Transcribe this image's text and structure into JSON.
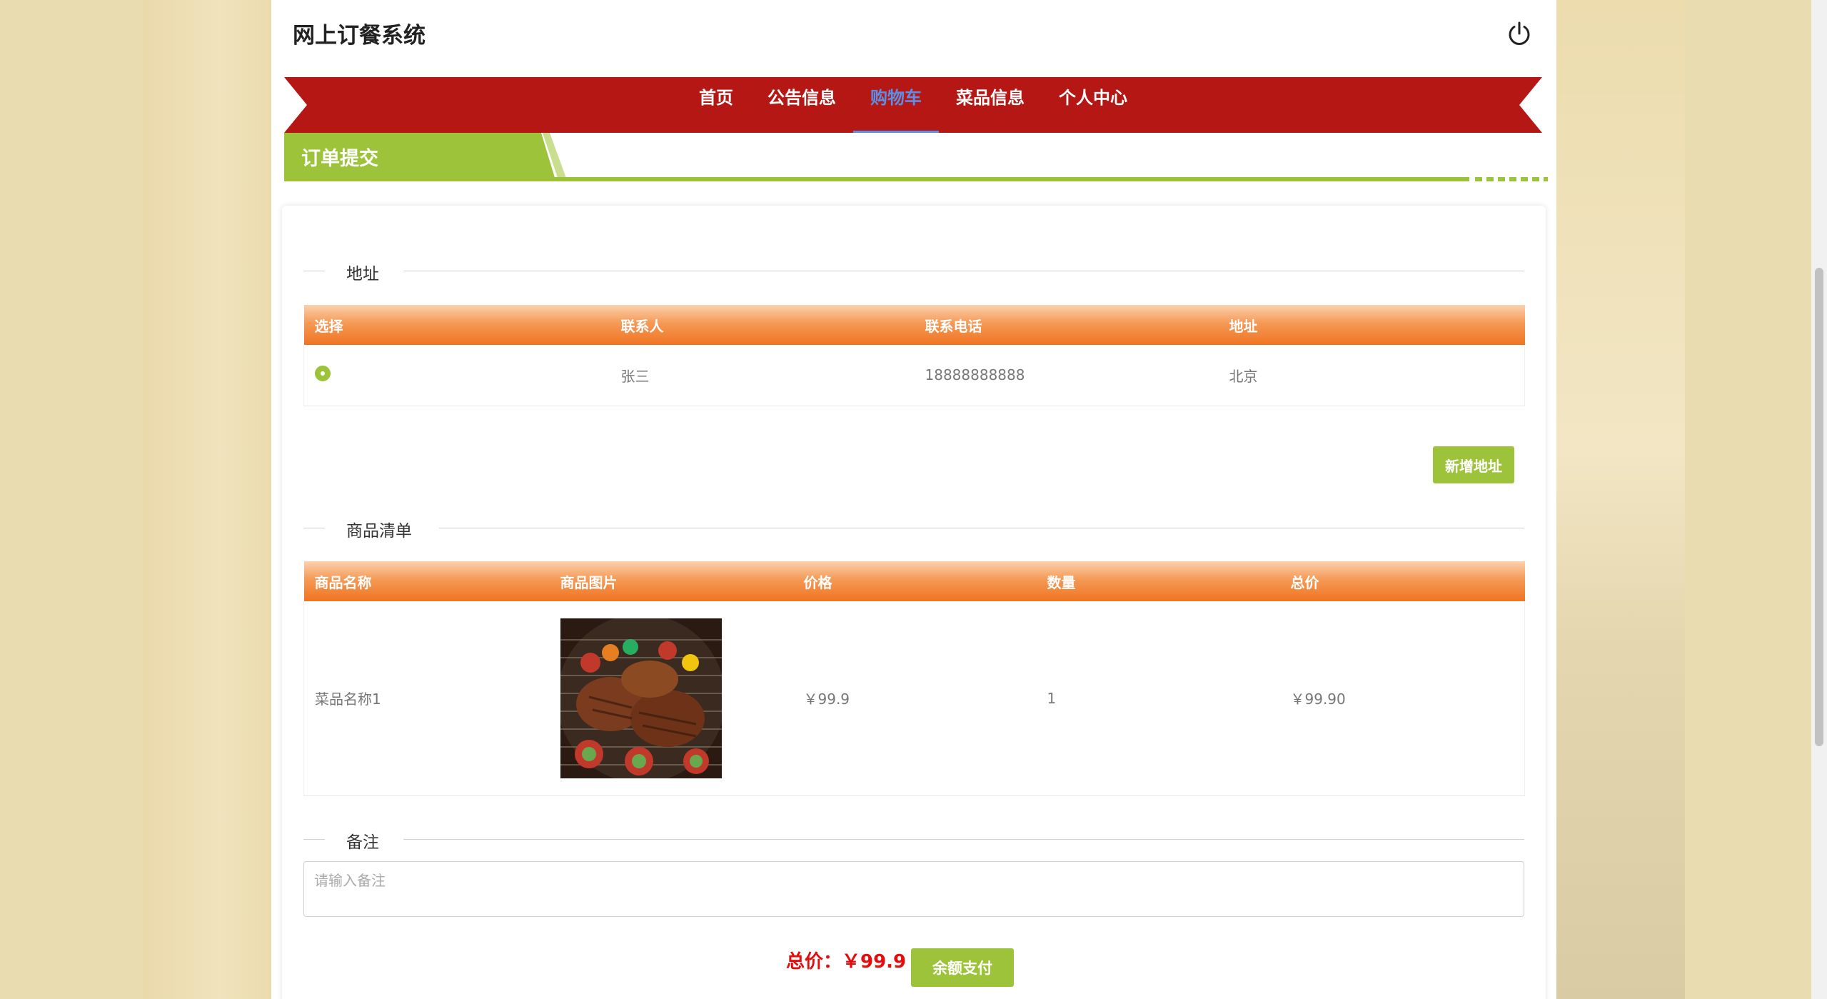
{
  "header": {
    "site_title": "网上订餐系统",
    "logout_icon": "power-icon"
  },
  "nav": {
    "items": [
      {
        "label": "首页",
        "active": false
      },
      {
        "label": "公告信息",
        "active": false
      },
      {
        "label": "购物车",
        "active": true
      },
      {
        "label": "菜品信息",
        "active": false
      },
      {
        "label": "个人中心",
        "active": false
      }
    ],
    "ribbon_color": "#b51714",
    "active_color": "#5b8ee6"
  },
  "section": {
    "title": "订单提交",
    "accent_color": "#9dc33b"
  },
  "address": {
    "legend": "地址",
    "columns": [
      "选择",
      "联系人",
      "联系电话",
      "地址"
    ],
    "rows": [
      {
        "selected": true,
        "contact": "张三",
        "phone": "18888888888",
        "address": "北京"
      }
    ],
    "add_button": "新增地址"
  },
  "goods": {
    "legend": "商品清单",
    "columns": [
      "商品名称",
      "商品图片",
      "价格",
      "数量",
      "总价"
    ],
    "rows": [
      {
        "name": "菜品名称1",
        "image": "grilled-meat-photo",
        "price": "￥99.9",
        "quantity": "1",
        "total": "￥99.90"
      }
    ]
  },
  "remark": {
    "legend": "备注",
    "placeholder": "请输入备注"
  },
  "footer": {
    "total_label": "总价：￥99.9",
    "pay_button": "余额支付"
  },
  "header_gradient": [
    "#fbd1ae",
    "#ef7422"
  ]
}
